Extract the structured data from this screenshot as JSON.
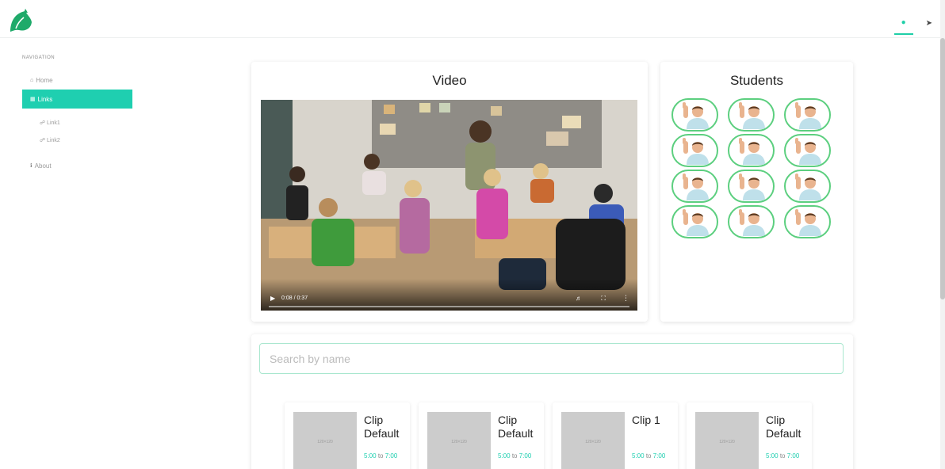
{
  "header": {
    "logo_icon": "leaf-icon",
    "user_icon": "user-icon",
    "exit_icon": "exit-icon",
    "accent_color": "#1fcfb0"
  },
  "sidebar": {
    "heading": "NAVIGATION",
    "items": [
      {
        "label": "Home",
        "icon": "home-icon"
      },
      {
        "label": "Links",
        "icon": "grid-icon",
        "active": true
      },
      {
        "label": "About",
        "icon": "info-icon"
      }
    ],
    "sublinks": [
      {
        "label": "Link1",
        "icon": "link-icon"
      },
      {
        "label": "Link2",
        "icon": "link-icon"
      }
    ]
  },
  "video": {
    "title": "Video",
    "current_time": "0:08",
    "duration": "0:37",
    "progress": 0.0
  },
  "students": {
    "title": "Students",
    "count": 12,
    "avatar_icon": "student-avatar"
  },
  "search": {
    "placeholder": "Search by name",
    "value": ""
  },
  "clips": [
    {
      "title": "Clip Default",
      "thumb_label": "120×120",
      "start": "5:00",
      "to": "to",
      "end": "7:00"
    },
    {
      "title": "Clip Default",
      "thumb_label": "120×120",
      "start": "5:00",
      "to": "to",
      "end": "7:00"
    },
    {
      "title": "Clip 1",
      "thumb_label": "120×120",
      "start": "5:00",
      "to": "to",
      "end": "7:00"
    },
    {
      "title": "Clip Default",
      "thumb_label": "120×120",
      "start": "5:00",
      "to": "to",
      "end": "7:00"
    }
  ]
}
